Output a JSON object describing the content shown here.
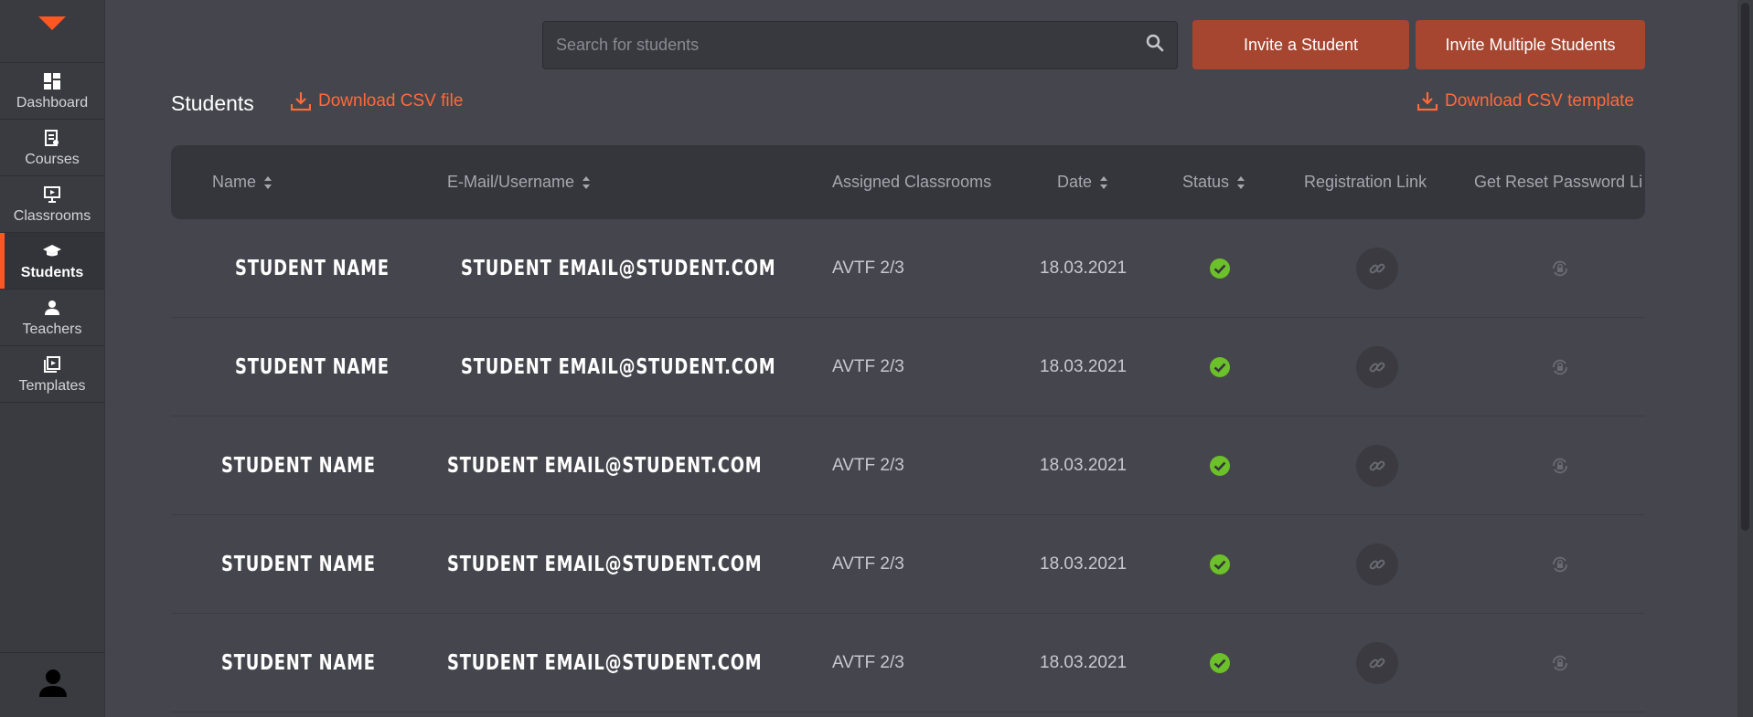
{
  "sidebar": {
    "items": [
      {
        "label": "Dashboard",
        "icon": "dashboard-icon",
        "active": false
      },
      {
        "label": "Courses",
        "icon": "courses-icon",
        "active": false
      },
      {
        "label": "Classrooms",
        "icon": "classrooms-icon",
        "active": false
      },
      {
        "label": "Students",
        "icon": "students-icon",
        "active": true
      },
      {
        "label": "Teachers",
        "icon": "teachers-icon",
        "active": false
      },
      {
        "label": "Templates",
        "icon": "templates-icon",
        "active": false
      }
    ]
  },
  "search": {
    "placeholder": "Search for students"
  },
  "actions": {
    "invite_label": "Invite a Student",
    "invite_multiple_label": "Invite Multiple Students"
  },
  "page": {
    "title": "Students",
    "download_csv_label": "Download CSV file",
    "download_template_label": "Download CSV template"
  },
  "table": {
    "columns": {
      "name": "Name",
      "email": "E-Mail/Username",
      "classrooms": "Assigned Classrooms",
      "date": "Date",
      "status": "Status",
      "registration": "Registration Link",
      "reset": "Get Reset Password Li"
    },
    "rows": [
      {
        "name": "STUDENT NAME",
        "email": "STUDENT EMAIL@STUDENT.COM",
        "classroom": "AVTF 2/3",
        "date": "18.03.2021",
        "status": "active"
      },
      {
        "name": "STUDENT NAME",
        "email": "STUDENT EMAIL@STUDENT.COM",
        "classroom": "AVTF 2/3",
        "date": "18.03.2021",
        "status": "active"
      },
      {
        "name": "STUDENT NAME",
        "email": "STUDENT EMAIL@STUDENT.COM",
        "classroom": "AVTF 2/3",
        "date": "18.03.2021",
        "status": "active"
      },
      {
        "name": "STUDENT NAME",
        "email": "STUDENT EMAIL@STUDENT.COM",
        "classroom": "AVTF 2/3",
        "date": "18.03.2021",
        "status": "active"
      },
      {
        "name": "STUDENT NAME",
        "email": "STUDENT EMAIL@STUDENT.COM",
        "classroom": "AVTF 2/3",
        "date": "18.03.2021",
        "status": "active"
      }
    ]
  },
  "colors": {
    "accent": "#ff5722",
    "button": "#a64630",
    "status_ok": "#6cc02a",
    "background": "#45454d",
    "sidebar": "#3a3a41"
  }
}
